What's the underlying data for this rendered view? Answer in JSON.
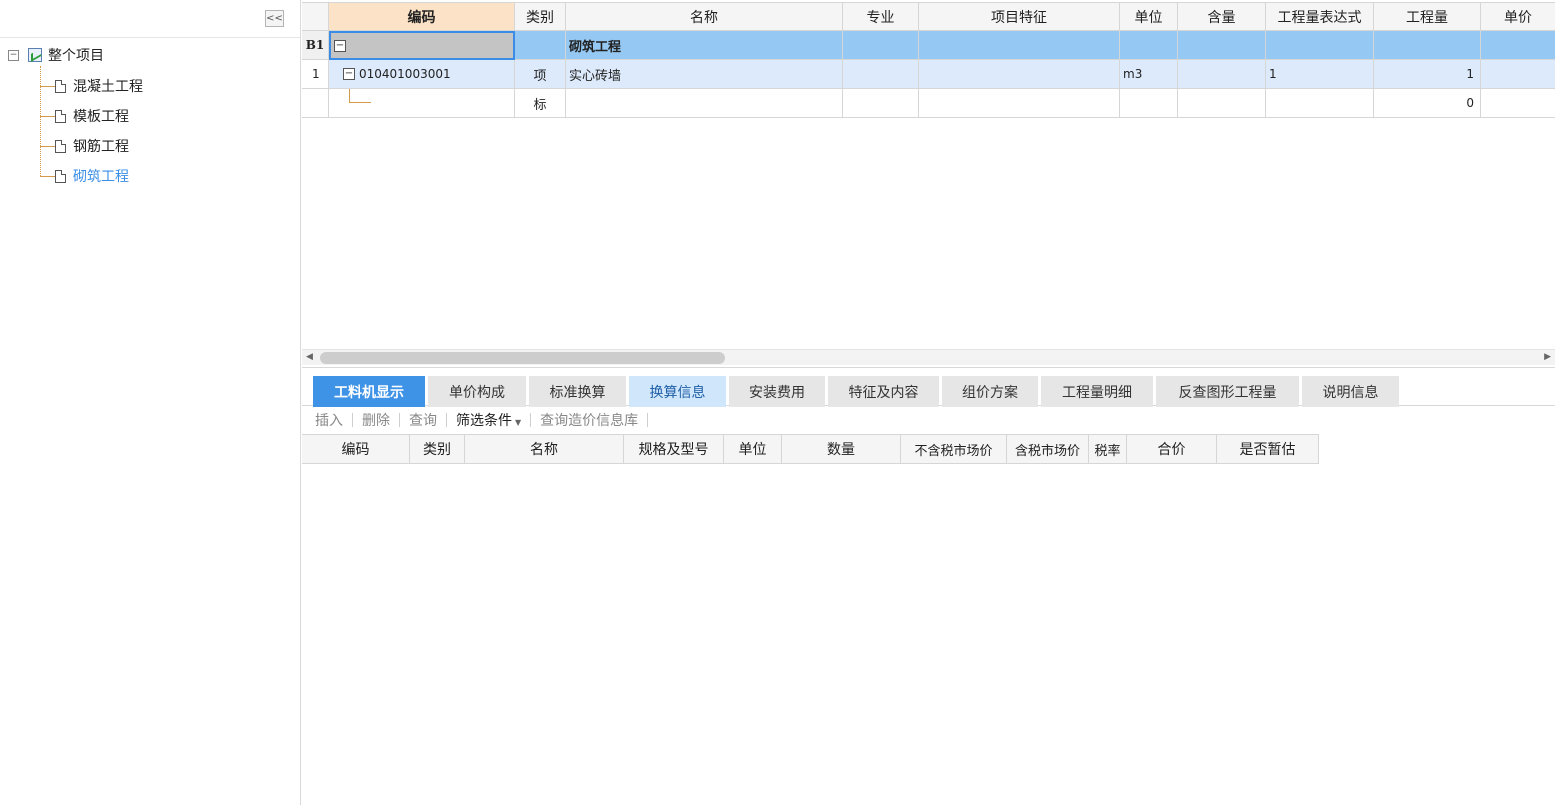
{
  "tree": {
    "collapse_label": "<<",
    "root": {
      "label": "整个项目",
      "expander": "⊟"
    },
    "items": [
      {
        "label": "混凝土工程",
        "selected": false
      },
      {
        "label": "模板工程",
        "selected": false
      },
      {
        "label": "钢筋工程",
        "selected": false
      },
      {
        "label": "砌筑工程",
        "selected": true
      }
    ]
  },
  "grid": {
    "headers": {
      "code": "编码",
      "type": "类别",
      "name": "名称",
      "major": "专业",
      "feature": "项目特征",
      "unit": "单位",
      "content": "含量",
      "expr": "工程量表达式",
      "qty": "工程量",
      "price": "单价"
    },
    "rows": [
      {
        "index": "B1",
        "code": "",
        "type": "",
        "name": "砌筑工程",
        "unit": "",
        "expr": "",
        "qty": ""
      },
      {
        "index": "1",
        "code": "010401003001",
        "type": "项",
        "name": "实心砖墙",
        "unit": "m3",
        "expr": "1",
        "qty": "1"
      },
      {
        "index": "",
        "code": "",
        "type": "标",
        "name": "",
        "unit": "",
        "expr": "",
        "qty": "0"
      }
    ]
  },
  "tabs": [
    {
      "label": "工料机显示",
      "state": "active"
    },
    {
      "label": "单价构成",
      "state": "normal"
    },
    {
      "label": "标准换算",
      "state": "normal"
    },
    {
      "label": "换算信息",
      "state": "light"
    },
    {
      "label": "安装费用",
      "state": "normal"
    },
    {
      "label": "特征及内容",
      "state": "normal"
    },
    {
      "label": "组价方案",
      "state": "normal"
    },
    {
      "label": "工程量明细",
      "state": "normal"
    },
    {
      "label": "反查图形工程量",
      "state": "normal"
    },
    {
      "label": "说明信息",
      "state": "normal"
    }
  ],
  "toolbar": {
    "insert": "插入",
    "delete": "删除",
    "query": "查询",
    "filter": "筛选条件",
    "price_lib": "查询造价信息库"
  },
  "subgrid": {
    "headers": [
      "编码",
      "类别",
      "名称",
      "规格及型号",
      "单位",
      "数量",
      "不含税市场价",
      "含税市场价",
      "税率",
      "合价",
      "是否暂估"
    ]
  }
}
